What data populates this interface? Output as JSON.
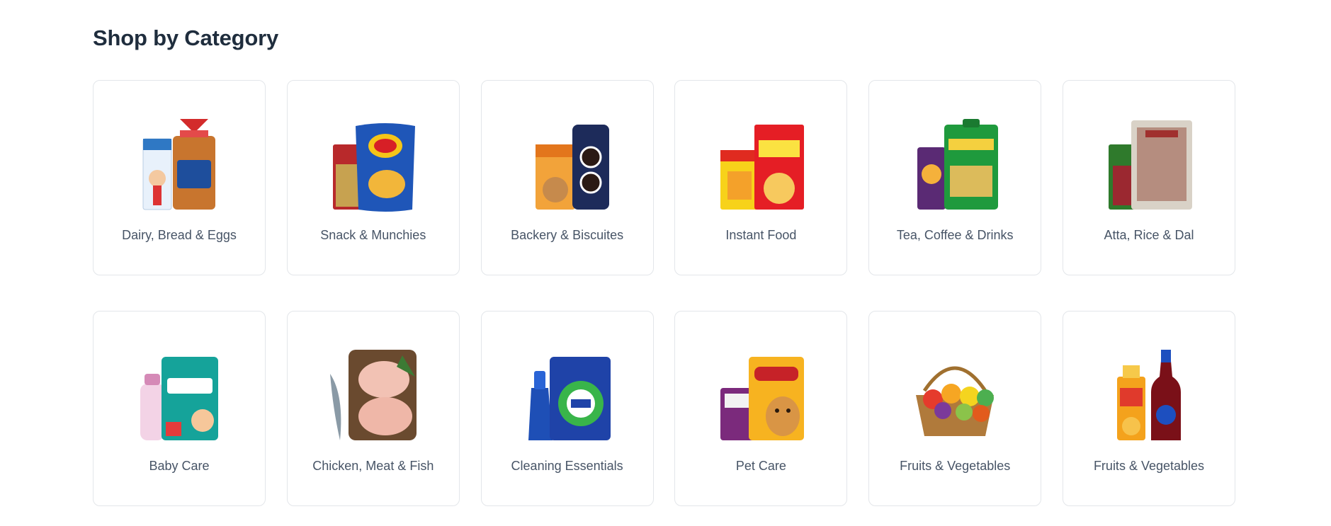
{
  "section": {
    "title": "Shop by Category"
  },
  "categories": [
    {
      "label": "Dairy, Bread & Eggs",
      "icon": "dairy-bread-eggs-icon"
    },
    {
      "label": "Snack & Munchies",
      "icon": "snack-munchies-icon"
    },
    {
      "label": "Backery & Biscuites",
      "icon": "bakery-biscuits-icon"
    },
    {
      "label": "Instant Food",
      "icon": "instant-food-icon"
    },
    {
      "label": "Tea, Coffee & Drinks",
      "icon": "tea-coffee-drinks-icon"
    },
    {
      "label": "Atta, Rice & Dal",
      "icon": "atta-rice-dal-icon"
    },
    {
      "label": "Baby Care",
      "icon": "baby-care-icon"
    },
    {
      "label": "Chicken, Meat & Fish",
      "icon": "chicken-meat-fish-icon"
    },
    {
      "label": "Cleaning Essentials",
      "icon": "cleaning-essentials-icon"
    },
    {
      "label": "Pet Care",
      "icon": "pet-care-icon"
    },
    {
      "label": "Fruits & Vegetables",
      "icon": "fruits-vegetables-icon"
    },
    {
      "label": "Fruits & Vegetables",
      "icon": "drinks-bottles-icon"
    }
  ],
  "colors": {
    "title": "#1f2d3d",
    "label": "#475466",
    "border": "#e3e6ea"
  }
}
